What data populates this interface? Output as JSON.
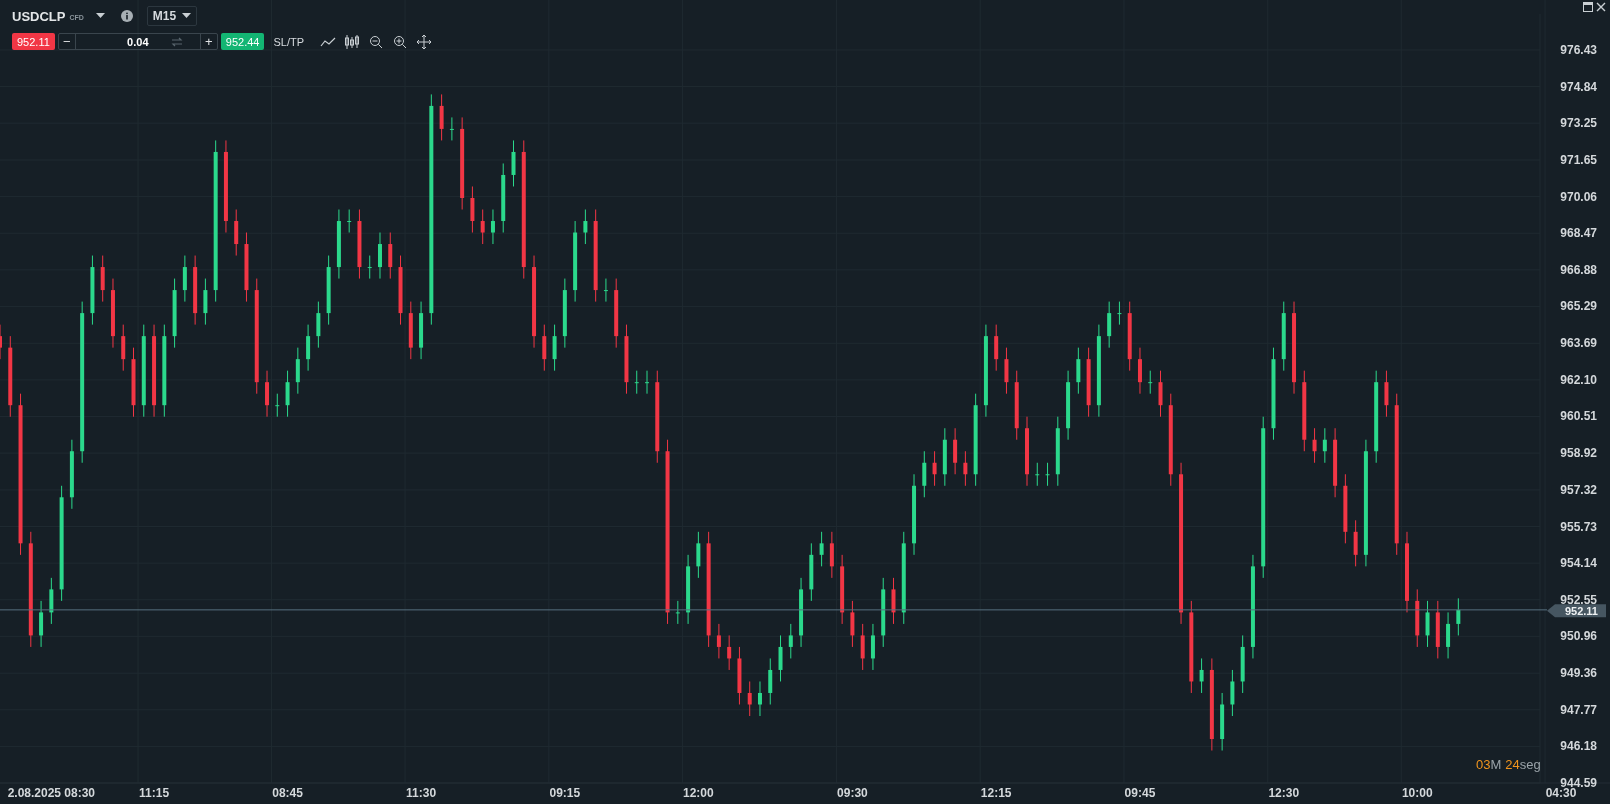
{
  "instrument": {
    "symbol": "USDCLP",
    "type": "CFD",
    "timeframe": "M15"
  },
  "trade_bar": {
    "sell_price": "952.11",
    "decrease": "−",
    "quantity": "0.04",
    "increase": "+",
    "buy_price": "952.44",
    "sl_tp": "SL/TP"
  },
  "chart": {
    "chart_data": {
      "type": "candlestick",
      "grid": true,
      "ylim": [
        944.59,
        978.6
      ],
      "yticks": [
        {
          "value": 976.43,
          "label": "976.43"
        },
        {
          "value": 974.84,
          "label": "974.84"
        },
        {
          "value": 973.25,
          "label": "973.25"
        },
        {
          "value": 971.65,
          "label": "971.65"
        },
        {
          "value": 970.06,
          "label": "970.06"
        },
        {
          "value": 968.47,
          "label": "968.47"
        },
        {
          "value": 966.88,
          "label": "966.88"
        },
        {
          "value": 965.29,
          "label": "965.29"
        },
        {
          "value": 963.69,
          "label": "963.69"
        },
        {
          "value": 962.1,
          "label": "962.10"
        },
        {
          "value": 960.51,
          "label": "960.51"
        },
        {
          "value": 958.92,
          "label": "958.92"
        },
        {
          "value": 957.32,
          "label": "957.32"
        },
        {
          "value": 955.73,
          "label": "955.73"
        },
        {
          "value": 954.14,
          "label": "954.14"
        },
        {
          "value": 952.55,
          "label": "952.55"
        },
        {
          "value": 950.96,
          "label": "950.96"
        },
        {
          "value": 949.36,
          "label": "949.36"
        },
        {
          "value": 947.77,
          "label": "947.77"
        },
        {
          "value": 946.18,
          "label": "946.18"
        },
        {
          "value": 944.59,
          "label": "944.59"
        }
      ],
      "categories": [
        null,
        null,
        null,
        null,
        null,
        "2.08.2025 08:30",
        null,
        null,
        null,
        null,
        null,
        null,
        null,
        null,
        null,
        "11:15",
        null,
        null,
        null,
        null,
        null,
        null,
        null,
        null,
        null,
        null,
        null,
        null,
        "08:45",
        null,
        null,
        null,
        null,
        null,
        null,
        null,
        null,
        null,
        null,
        null,
        null,
        "11:30",
        null,
        null,
        null,
        null,
        null,
        null,
        null,
        null,
        null,
        null,
        null,
        null,
        null,
        "09:15",
        null,
        null,
        null,
        null,
        null,
        null,
        null,
        null,
        null,
        null,
        null,
        null,
        "12:00",
        null,
        null,
        null,
        null,
        null,
        null,
        null,
        null,
        null,
        null,
        null,
        null,
        null,
        null,
        "09:30",
        null,
        null,
        null,
        null,
        null,
        null,
        null,
        null,
        null,
        null,
        null,
        null,
        null,
        "12:15",
        null,
        null,
        null,
        null,
        null,
        null,
        null,
        null,
        null,
        null,
        null,
        null,
        null,
        "09:45",
        null,
        null,
        null,
        null,
        null,
        null,
        null,
        null,
        null,
        null,
        null,
        null,
        null,
        "12:30",
        null,
        null,
        null,
        null,
        null,
        null,
        null,
        null,
        null,
        null,
        null,
        null,
        "10:00",
        null,
        null,
        null,
        null,
        null,
        null,
        null,
        null,
        null,
        null,
        null,
        null,
        null,
        "04:30"
      ],
      "ohlc": [
        [
          964,
          964.5,
          963,
          963.5
        ],
        [
          963.5,
          964,
          960.5,
          961
        ],
        [
          961,
          961.5,
          954.5,
          955
        ],
        [
          955,
          955.5,
          950.5,
          951
        ],
        [
          951,
          952.5,
          950.5,
          952
        ],
        [
          952,
          953.5,
          951.5,
          953
        ],
        [
          953,
          957.5,
          952.5,
          957
        ],
        [
          957,
          959.5,
          956.5,
          959
        ],
        [
          959,
          965.5,
          958.5,
          965
        ],
        [
          965,
          967.5,
          964.5,
          967
        ],
        [
          967,
          967.5,
          965.5,
          966
        ],
        [
          966,
          966.5,
          963.5,
          964
        ],
        [
          964,
          964.5,
          962.5,
          963
        ],
        [
          963,
          963.5,
          960.5,
          961
        ],
        [
          961,
          964.5,
          960.5,
          964
        ],
        [
          964,
          964.5,
          960.5,
          961
        ],
        [
          961,
          964.5,
          960.5,
          964
        ],
        [
          964,
          966.5,
          963.5,
          966
        ],
        [
          966,
          967.5,
          965.5,
          967
        ],
        [
          967,
          967.5,
          964.5,
          965
        ],
        [
          965,
          966.5,
          964.5,
          966
        ],
        [
          966,
          972.5,
          965.5,
          972
        ],
        [
          972,
          972.5,
          968.5,
          969
        ],
        [
          969,
          969.5,
          967.5,
          968
        ],
        [
          968,
          968.5,
          965.5,
          966
        ],
        [
          966,
          966.5,
          961.5,
          962
        ],
        [
          962,
          962.5,
          960.5,
          961
        ],
        [
          961,
          961.5,
          960.5,
          961
        ],
        [
          961,
          962.5,
          960.5,
          962
        ],
        [
          962,
          963.5,
          961.5,
          963
        ],
        [
          963,
          964.5,
          962.5,
          964
        ],
        [
          964,
          965.5,
          963.5,
          965
        ],
        [
          965,
          967.5,
          964.5,
          967
        ],
        [
          967,
          969.5,
          966.5,
          969
        ],
        [
          969,
          969.5,
          968.5,
          969
        ],
        [
          969,
          969.5,
          966.5,
          967
        ],
        [
          967,
          967.5,
          966.5,
          967
        ],
        [
          967,
          968.5,
          966.5,
          968
        ],
        [
          968,
          968.5,
          966.5,
          967
        ],
        [
          967,
          967.5,
          964.5,
          965
        ],
        [
          965,
          965.5,
          963,
          963.5
        ],
        [
          963.5,
          965.5,
          963,
          965
        ],
        [
          965,
          974.5,
          964.5,
          974
        ],
        [
          974,
          974.5,
          972.5,
          973
        ],
        [
          973,
          973.5,
          972.5,
          973
        ],
        [
          973,
          973.5,
          969.5,
          970
        ],
        [
          970,
          970.5,
          968.5,
          969
        ],
        [
          969,
          969.5,
          968,
          968.5
        ],
        [
          968.5,
          969.5,
          968,
          969
        ],
        [
          969,
          971.5,
          968.5,
          971
        ],
        [
          971,
          972.5,
          970.5,
          972
        ],
        [
          972,
          972.5,
          966.5,
          967
        ],
        [
          967,
          967.5,
          963.5,
          964
        ],
        [
          964,
          964.5,
          962.5,
          963
        ],
        [
          963,
          964.5,
          962.5,
          964
        ],
        [
          964,
          966.5,
          963.5,
          966
        ],
        [
          966,
          969,
          965.5,
          968.5
        ],
        [
          968.5,
          969.5,
          968,
          969
        ],
        [
          969,
          969.5,
          965.5,
          966
        ],
        [
          966,
          966.5,
          965.5,
          966
        ],
        [
          966,
          966.5,
          963.5,
          964
        ],
        [
          964,
          964.5,
          961.5,
          962
        ],
        [
          962,
          962.5,
          961.5,
          962
        ],
        [
          962,
          962.5,
          961.5,
          962
        ],
        [
          962,
          962.5,
          958.5,
          959
        ],
        [
          959,
          959.5,
          951.5,
          952
        ],
        [
          952,
          952.5,
          951.5,
          952
        ],
        [
          952,
          954.5,
          951.5,
          954
        ],
        [
          954,
          955.5,
          953.5,
          955
        ],
        [
          955,
          955.5,
          950.5,
          951
        ],
        [
          951,
          951.5,
          950,
          950.5
        ],
        [
          950.5,
          951,
          949.5,
          950
        ],
        [
          950,
          950.5,
          948,
          948.5
        ],
        [
          948.5,
          949,
          947.5,
          948
        ],
        [
          948,
          949,
          947.5,
          948.5
        ],
        [
          948.5,
          950,
          948,
          949.5
        ],
        [
          949.5,
          951,
          949,
          950.5
        ],
        [
          950.5,
          951.5,
          950,
          951
        ],
        [
          951,
          953.5,
          950.5,
          953
        ],
        [
          953,
          955,
          952.5,
          954.5
        ],
        [
          954.5,
          955.5,
          954,
          955
        ],
        [
          955,
          955.5,
          953.5,
          954
        ],
        [
          954,
          954.5,
          951.5,
          952
        ],
        [
          952,
          952.5,
          950.5,
          951
        ],
        [
          951,
          951.5,
          949.5,
          950
        ],
        [
          950,
          951.5,
          949.5,
          951
        ],
        [
          951,
          953.5,
          950.5,
          953
        ],
        [
          953,
          953.5,
          951.5,
          952
        ],
        [
          952,
          955.5,
          951.5,
          955
        ],
        [
          955,
          958,
          954.5,
          957.5
        ],
        [
          957.5,
          959,
          957,
          958.5
        ],
        [
          958.5,
          959,
          957.5,
          958
        ],
        [
          958,
          960,
          957.5,
          959.5
        ],
        [
          959.5,
          960,
          958,
          958.5
        ],
        [
          958.5,
          959,
          957.5,
          958
        ],
        [
          958,
          961.5,
          957.5,
          961
        ],
        [
          961,
          964.5,
          960.5,
          964
        ],
        [
          964,
          964.5,
          962.5,
          963
        ],
        [
          963,
          963.5,
          961.5,
          962
        ],
        [
          962,
          962.5,
          959.5,
          960
        ],
        [
          960,
          960.5,
          957.5,
          958
        ],
        [
          958,
          958.5,
          957.5,
          958
        ],
        [
          958,
          958.5,
          957.5,
          958
        ],
        [
          958,
          960.5,
          957.5,
          960
        ],
        [
          960,
          962.5,
          959.5,
          962
        ],
        [
          962,
          963.5,
          961.5,
          963
        ],
        [
          963,
          963.5,
          960.5,
          961
        ],
        [
          961,
          964.5,
          960.5,
          964
        ],
        [
          964,
          965.5,
          963.5,
          965
        ],
        [
          965,
          965.5,
          964.5,
          965
        ],
        [
          965,
          965.5,
          962.5,
          963
        ],
        [
          963,
          963.5,
          961.5,
          962
        ],
        [
          962,
          962.5,
          961.5,
          962
        ],
        [
          962,
          962.5,
          960.5,
          961
        ],
        [
          961,
          961.5,
          957.5,
          958
        ],
        [
          958,
          958.5,
          951.5,
          952
        ],
        [
          952,
          952.5,
          948.5,
          949
        ],
        [
          949,
          950,
          948.5,
          949.5
        ],
        [
          949.5,
          950,
          946,
          946.5
        ],
        [
          946.5,
          948.5,
          946,
          948
        ],
        [
          948,
          949.5,
          947.5,
          949
        ],
        [
          949,
          951,
          948.5,
          950.5
        ],
        [
          950.5,
          954.5,
          950,
          954
        ],
        [
          954,
          960.5,
          953.5,
          960
        ],
        [
          960,
          963.5,
          959.5,
          963
        ],
        [
          963,
          965.5,
          962.5,
          965
        ],
        [
          965,
          965.5,
          961.5,
          962
        ],
        [
          962,
          962.5,
          959,
          959.5
        ],
        [
          959.5,
          960,
          958.5,
          959
        ],
        [
          959,
          960,
          958.5,
          959.5
        ],
        [
          959.5,
          960,
          957,
          957.5
        ],
        [
          957.5,
          958,
          955,
          955.5
        ],
        [
          955.5,
          956,
          954,
          954.5
        ],
        [
          954.5,
          959.5,
          954,
          959
        ],
        [
          959,
          962.5,
          958.5,
          962
        ],
        [
          962,
          962.5,
          960.5,
          961
        ],
        [
          961,
          961.5,
          954.5,
          955
        ],
        [
          955,
          955.5,
          952,
          952.5
        ],
        [
          952.5,
          953,
          950.5,
          951
        ],
        [
          951,
          952.5,
          950.5,
          952
        ],
        [
          952,
          952.5,
          950,
          950.5
        ],
        [
          950.5,
          952,
          950,
          951.5
        ],
        [
          951.5,
          952.61,
          951,
          952.11
        ],
        null,
        null,
        null,
        null,
        null,
        null,
        null,
        null,
        null,
        null
      ],
      "ref_lines": [
        {
          "axis": "y",
          "value": 952.11,
          "label": "952.11",
          "color": "#56707f"
        }
      ]
    },
    "countdown": {
      "minutes": "03",
      "minutes_unit": "M",
      "seconds": "24",
      "seconds_unit": "seg"
    }
  }
}
